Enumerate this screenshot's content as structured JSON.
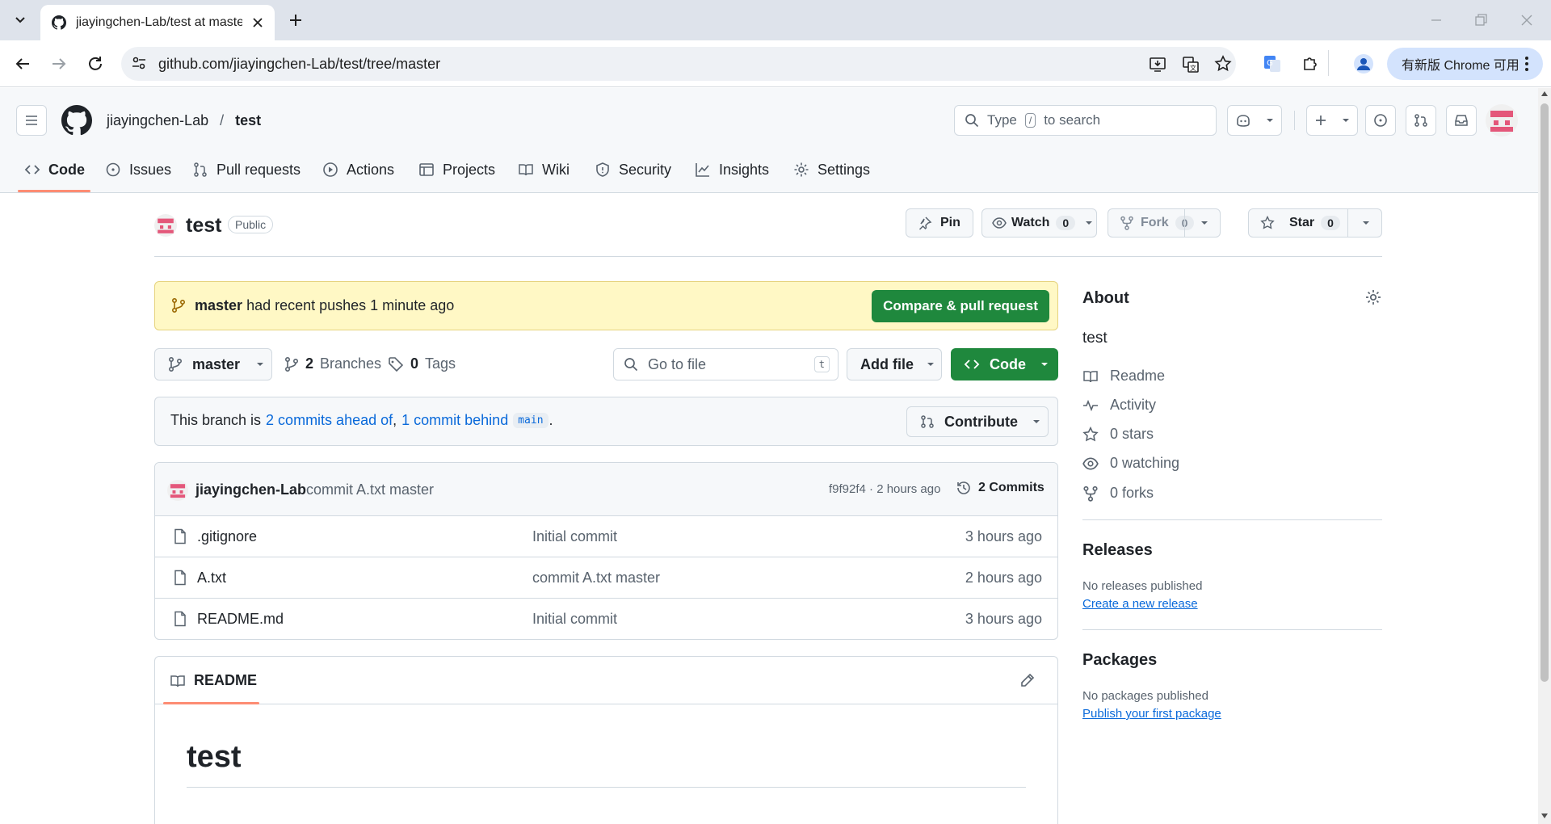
{
  "browser": {
    "tab_title": "jiayingchen-Lab/test at master",
    "url": "github.com/jiayingchen-Lab/test/tree/master",
    "update_label": "有新版 Chrome 可用"
  },
  "header": {
    "owner": "jiayingchen-Lab",
    "separator": "/",
    "repo": "test",
    "search_placeholder_pre": "Type",
    "search_key": "/",
    "search_placeholder_post": "to search"
  },
  "nav": {
    "tabs": [
      {
        "label": "Code"
      },
      {
        "label": "Issues"
      },
      {
        "label": "Pull requests"
      },
      {
        "label": "Actions"
      },
      {
        "label": "Projects"
      },
      {
        "label": "Wiki"
      },
      {
        "label": "Security"
      },
      {
        "label": "Insights"
      },
      {
        "label": "Settings"
      }
    ]
  },
  "repo": {
    "name": "test",
    "visibility": "Public",
    "pin_label": "Pin",
    "watch_label": "Watch",
    "watch_count": "0",
    "fork_label": "Fork",
    "fork_count": "0",
    "star_label": "Star",
    "star_count": "0"
  },
  "banner": {
    "branch": "master",
    "text": "had recent pushes 1 minute ago",
    "button": "Compare & pull request"
  },
  "toolbar": {
    "branch": "master",
    "branches_count": "2",
    "branches_label": "Branches",
    "tags_count": "0",
    "tags_label": "Tags",
    "goto_placeholder": "Go to file",
    "goto_key": "t",
    "add_file": "Add file",
    "code": "Code"
  },
  "compare": {
    "prefix": "This branch is",
    "ahead": "2 commits ahead of",
    "comma": ",",
    "behind": "1 commit behind",
    "base": "main",
    "suffix": ".",
    "contribute": "Contribute"
  },
  "commit": {
    "author": "jiayingchen-Lab",
    "message": "commit A.txt master",
    "meta": "f9f92f4 · 2 hours ago",
    "commits": "2 Commits"
  },
  "files": [
    {
      "name": ".gitignore",
      "message": "Initial commit",
      "age": "3 hours ago"
    },
    {
      "name": "A.txt",
      "message": "commit A.txt master",
      "age": "2 hours ago"
    },
    {
      "name": "README.md",
      "message": "Initial commit",
      "age": "3 hours ago"
    }
  ],
  "readme": {
    "tab": "README",
    "heading": "test"
  },
  "about": {
    "title": "About",
    "description": "test",
    "readme": "Readme",
    "activity": "Activity",
    "stars": "0 stars",
    "watching": "0 watching",
    "forks": "0 forks"
  },
  "releases": {
    "title": "Releases",
    "none": "No releases published",
    "link": "Create a new release"
  },
  "packages": {
    "title": "Packages",
    "none": "No packages published",
    "link": "Publish your first package"
  },
  "colors": {
    "accent_green": "#1f883d",
    "link_blue": "#0969da",
    "banner_bg": "#fff8c5",
    "tab_underline": "#fd8c73"
  }
}
